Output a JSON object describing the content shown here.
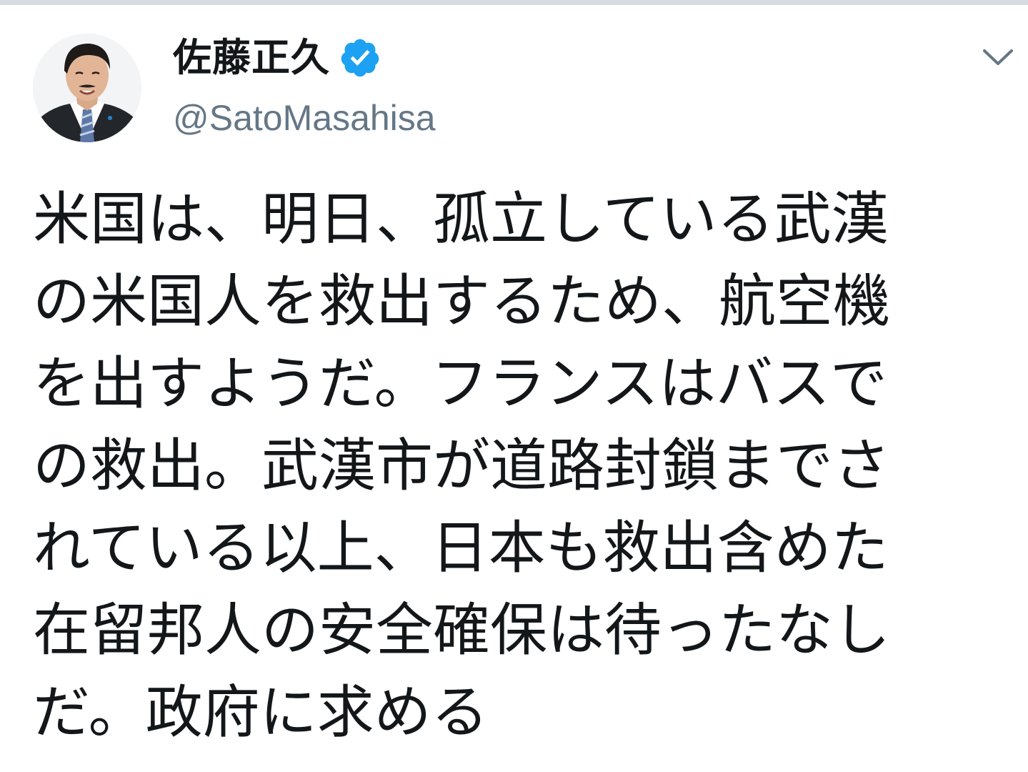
{
  "author": {
    "display_name": "佐藤正久",
    "handle": "@SatoMasahisa",
    "verified": true,
    "verified_icon": "verified-badge-icon"
  },
  "menu": {
    "icon": "chevron-down-icon"
  },
  "tweet": {
    "lines": [
      "米国は、明日、孤立している武漢",
      "の米国人を救出するため、航空機",
      "を出すようだ。フランスはバスで",
      "の救出。武漢市が道路封鎖までさ",
      "れている以上、日本も救出含めた",
      "在留邦人の安全確保は待ったなし",
      "だ。政府に求める"
    ]
  },
  "colors": {
    "text": "#14171a",
    "secondary": "#657786",
    "verified_blue": "#1da1f2",
    "divider": "#d6dbe0"
  }
}
